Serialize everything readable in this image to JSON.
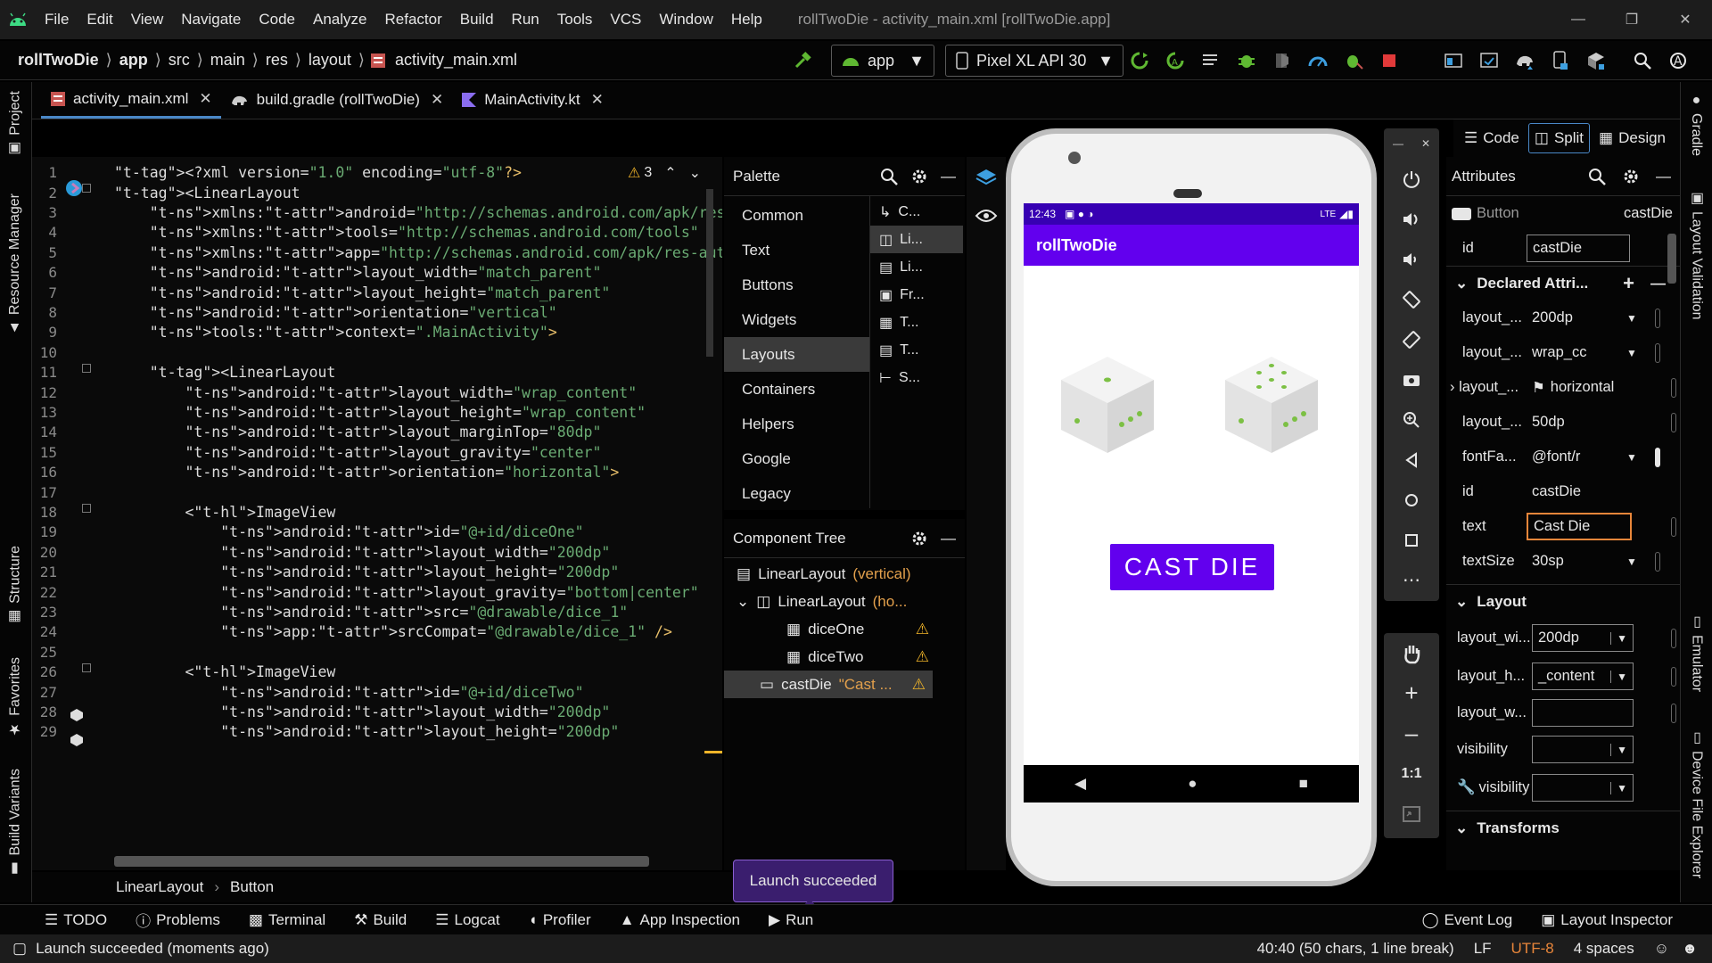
{
  "menubar": {
    "items": [
      "File",
      "Edit",
      "View",
      "Navigate",
      "Code",
      "Analyze",
      "Refactor",
      "Build",
      "Run",
      "Tools",
      "VCS",
      "Window",
      "Help"
    ],
    "window_title": "rollTwoDie - activity_main.xml [rollTwoDie.app]"
  },
  "navbar": {
    "breadcrumbs": [
      "rollTwoDie",
      "app",
      "src",
      "main",
      "res",
      "layout",
      "activity_main.xml"
    ],
    "run_config": "app",
    "device": "Pixel XL API 30"
  },
  "left_strip": [
    "Project",
    "Resource Manager",
    "Structure",
    "Favorites",
    "Build Variants"
  ],
  "right_strip": [
    "Gradle",
    "Layout Validation",
    "Emulator",
    "Device File Explorer"
  ],
  "tabs": [
    {
      "label": "activity_main.xml",
      "active": true
    },
    {
      "label": "build.gradle (rollTwoDie)",
      "active": false
    },
    {
      "label": "MainActivity.kt",
      "active": false
    }
  ],
  "editor": {
    "warning_count": "3",
    "lines": [
      {
        "n": "1",
        "code": "<?xml version=\"1.0\" encoding=\"utf-8\"?>"
      },
      {
        "n": "2",
        "code": "<LinearLayout"
      },
      {
        "n": "3",
        "code": "    xmlns:android=\"http://schemas.android.com/apk/res/android\""
      },
      {
        "n": "4",
        "code": "    xmlns:tools=\"http://schemas.android.com/tools\""
      },
      {
        "n": "5",
        "code": "    xmlns:app=\"http://schemas.android.com/apk/res-auto\""
      },
      {
        "n": "6",
        "code": "    android:layout_width=\"match_parent\""
      },
      {
        "n": "7",
        "code": "    android:layout_height=\"match_parent\""
      },
      {
        "n": "8",
        "code": "    android:orientation=\"vertical\""
      },
      {
        "n": "9",
        "code": "    tools:context=\".MainActivity\">"
      },
      {
        "n": "10",
        "code": ""
      },
      {
        "n": "11",
        "code": "    <LinearLayout"
      },
      {
        "n": "12",
        "code": "        android:layout_width=\"wrap_content\""
      },
      {
        "n": "13",
        "code": "        android:layout_height=\"wrap_content\""
      },
      {
        "n": "14",
        "code": "        android:layout_marginTop=\"80dp\""
      },
      {
        "n": "15",
        "code": "        android:layout_gravity=\"center\""
      },
      {
        "n": "16",
        "code": "        android:orientation=\"horizontal\">"
      },
      {
        "n": "17",
        "code": ""
      },
      {
        "n": "18",
        "code": "        <ImageView"
      },
      {
        "n": "19",
        "code": "            android:id=\"@+id/diceOne\""
      },
      {
        "n": "20",
        "code": "            android:layout_width=\"200dp\""
      },
      {
        "n": "21",
        "code": "            android:layout_height=\"200dp\""
      },
      {
        "n": "22",
        "code": "            android:layout_gravity=\"bottom|center\""
      },
      {
        "n": "23",
        "code": "            android:src=\"@drawable/dice_1\""
      },
      {
        "n": "24",
        "code": "            app:srcCompat=\"@drawable/dice_1\" />"
      },
      {
        "n": "25",
        "code": ""
      },
      {
        "n": "26",
        "code": "        <ImageView"
      },
      {
        "n": "27",
        "code": "            android:id=\"@+id/diceTwo\""
      },
      {
        "n": "28",
        "code": "            android:layout_width=\"200dp\""
      },
      {
        "n": "29",
        "code": "            android:layout_height=\"200dp\""
      }
    ]
  },
  "palette": {
    "title": "Palette",
    "categories": [
      "Common",
      "Text",
      "Buttons",
      "Widgets",
      "Layouts",
      "Containers",
      "Helpers",
      "Google",
      "Legacy"
    ],
    "selected": "Layouts",
    "items": [
      "C...",
      "Li...",
      "Li...",
      "Fr...",
      "T...",
      "T...",
      "S..."
    ]
  },
  "component_tree": {
    "title": "Component Tree",
    "rows": [
      {
        "name": "LinearLayout",
        "sub": "(vertical)"
      },
      {
        "name": "LinearLayout",
        "sub": "(ho..."
      },
      {
        "name": "diceOne",
        "sub": ""
      },
      {
        "name": "diceTwo",
        "sub": ""
      },
      {
        "name": "castDie",
        "sub": "\"Cast ..."
      }
    ]
  },
  "phone": {
    "time": "12:43",
    "status_right": "LTE",
    "app_title": "rollTwoDie",
    "button_label": "CAST DIE",
    "accent": "#6200ee",
    "statusbar_color": "#3700b3"
  },
  "view_modes": [
    "Code",
    "Split",
    "Design"
  ],
  "attributes": {
    "title": "Attributes",
    "widget_type": "Button",
    "widget_id": "castDie",
    "id_value": "castDie",
    "declared_title": "Declared Attri...",
    "declared": [
      {
        "k": "layout_...",
        "v": "200dp"
      },
      {
        "k": "layout_...",
        "v": "wrap_cc"
      },
      {
        "k": "layout_...",
        "v": "horizontal"
      },
      {
        "k": "layout_...",
        "v": "50dp"
      },
      {
        "k": "fontFa...",
        "v": "@font/r"
      },
      {
        "k": "id",
        "v": "castDie"
      },
      {
        "k": "text",
        "v": "Cast Die"
      },
      {
        "k": "textSize",
        "v": "30sp"
      }
    ],
    "layout_title": "Layout",
    "layout": [
      {
        "k": "layout_wi...",
        "v": "200dp"
      },
      {
        "k": "layout_h...",
        "v": "_content"
      },
      {
        "k": "layout_w...",
        "v": ""
      },
      {
        "k": "visibility",
        "v": ""
      },
      {
        "k": "visibility",
        "v": ""
      }
    ],
    "transforms_title": "Transforms"
  },
  "breadcrumb_bottom": [
    "LinearLayout",
    "Button"
  ],
  "tooltip": "Launch succeeded",
  "toolwindows": [
    "TODO",
    "Problems",
    "Terminal",
    "Build",
    "Logcat",
    "Profiler",
    "App Inspection",
    "Run"
  ],
  "toolwindows_right": [
    "Event Log",
    "Layout Inspector"
  ],
  "status": {
    "message": "Launch succeeded (moments ago)",
    "position": "40:40 (50 chars, 1 line break)",
    "line_sep": "LF",
    "encoding": "UTF-8",
    "indent": "4 spaces"
  }
}
